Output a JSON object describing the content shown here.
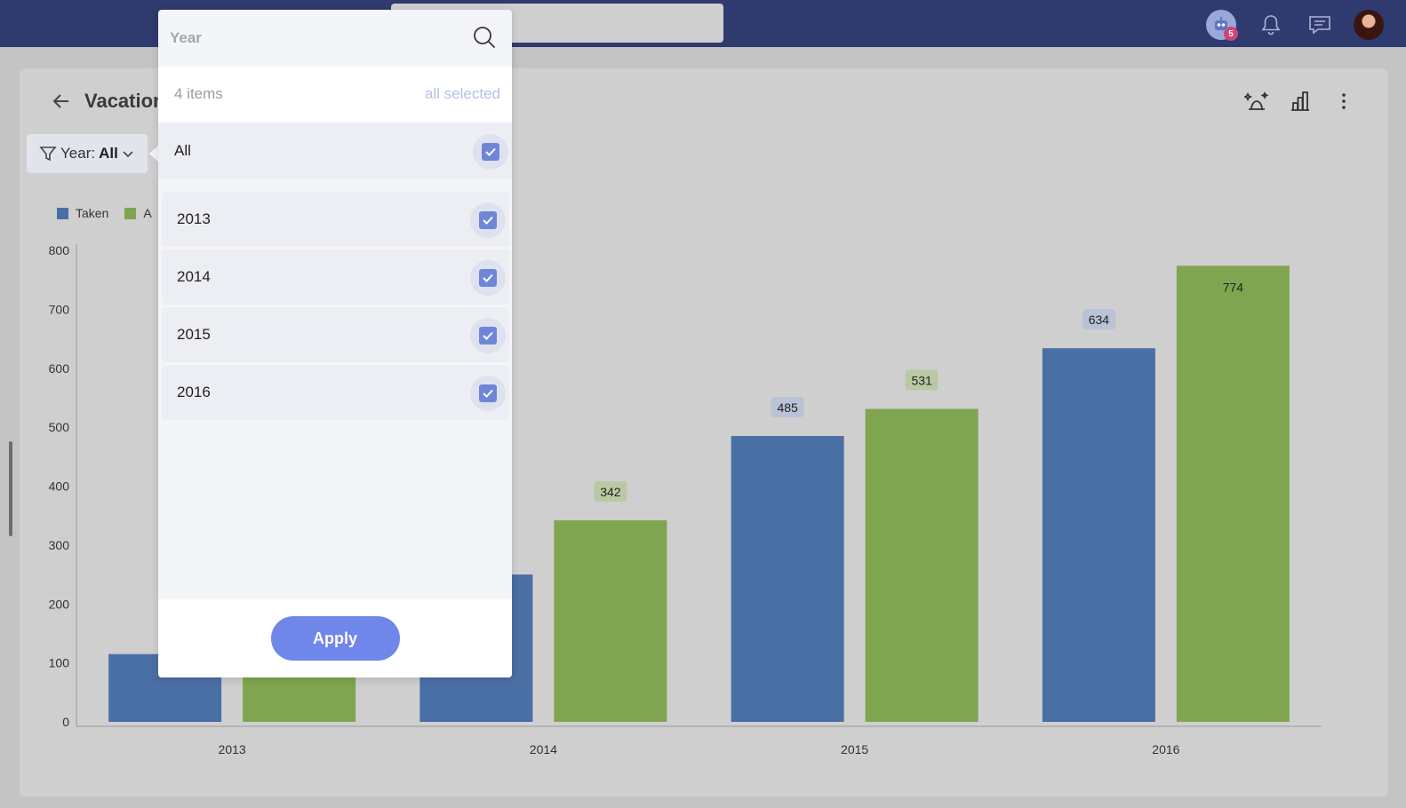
{
  "header": {
    "notification_count": "5"
  },
  "dashboard": {
    "title": "Vacation",
    "filter": {
      "label": "Year:",
      "value": "All"
    },
    "legend": [
      {
        "label": "Taken",
        "color": "#4a6fa5"
      },
      {
        "label": "A",
        "color": "#7fa550"
      }
    ]
  },
  "dropdown": {
    "search_placeholder": "Year",
    "count_text": "4 items",
    "selection_text": "all selected",
    "all_label": "All",
    "items": [
      {
        "label": "2013",
        "checked": true
      },
      {
        "label": "2014",
        "checked": true
      },
      {
        "label": "2015",
        "checked": true
      },
      {
        "label": "2016",
        "checked": true
      }
    ],
    "apply_label": "Apply"
  },
  "chart_data": {
    "type": "bar",
    "categories": [
      "2013",
      "2014",
      "2015",
      "2016"
    ],
    "series": [
      {
        "name": "Taken",
        "color": "#4a6fa5",
        "values": [
          115,
          250,
          485,
          634
        ],
        "labels": [
          "",
          "",
          "485",
          "634"
        ]
      },
      {
        "color": "#7fa550",
        "values": [
          90,
          342,
          531,
          774
        ],
        "labels": [
          "",
          "342",
          "531",
          "774"
        ]
      }
    ],
    "y_ticks": [
      "0",
      "100",
      "200",
      "300",
      "400",
      "500",
      "600",
      "700",
      "800"
    ],
    "ylim": [
      0,
      800
    ],
    "grid": false
  }
}
